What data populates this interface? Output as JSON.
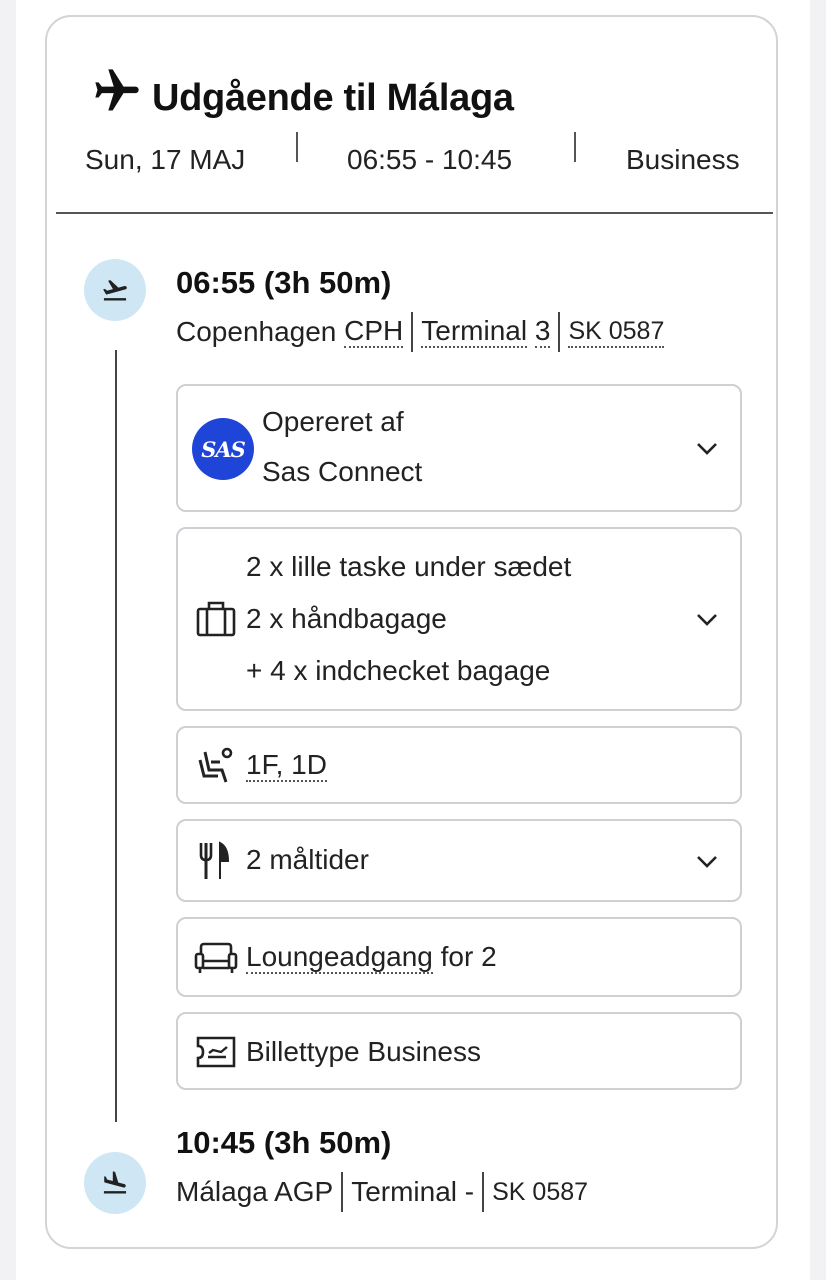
{
  "card": {
    "title": "Udgående til Málaga",
    "date": "Sun, 17 MAJ",
    "time_range": "06:55 - 10:45",
    "cabin": "Business"
  },
  "departure": {
    "time": "06:55 (3h 50m)",
    "city": "Copenhagen",
    "airport_code": "CPH",
    "terminal_label": "Terminal",
    "terminal_number": "3",
    "flight_number": "SK 0587"
  },
  "operator": {
    "logo_text": "SAS",
    "label": "Opereret af",
    "name": "Sas Connect"
  },
  "baggage": {
    "line1": "2 x lille taske under sædet",
    "line2": "2 x håndbagage",
    "line3": "+ 4 x indchecket bagage"
  },
  "seats": {
    "value": "1F, 1D"
  },
  "meals": {
    "value": "2 måltider"
  },
  "lounge": {
    "link": "Loungeadgang",
    "suffix": "for 2"
  },
  "ticket": {
    "value": "Billettype Business"
  },
  "arrival": {
    "time": "10:45 (3h 50m)",
    "city_code": "Málaga AGP",
    "terminal": "Terminal -",
    "flight_number": "SK 0587"
  },
  "icons": {
    "title": "airplane-icon",
    "departure": "takeoff-icon",
    "arrival": "landing-icon",
    "baggage": "suitcase-icon",
    "seat": "seat-icon",
    "meal": "cutlery-icon",
    "lounge": "sofa-icon",
    "ticket": "ticket-icon",
    "expand": "chevron-down-icon"
  },
  "colors": {
    "accent_circle": "#cfe6f5",
    "sas_blue": "#1f44d8"
  }
}
